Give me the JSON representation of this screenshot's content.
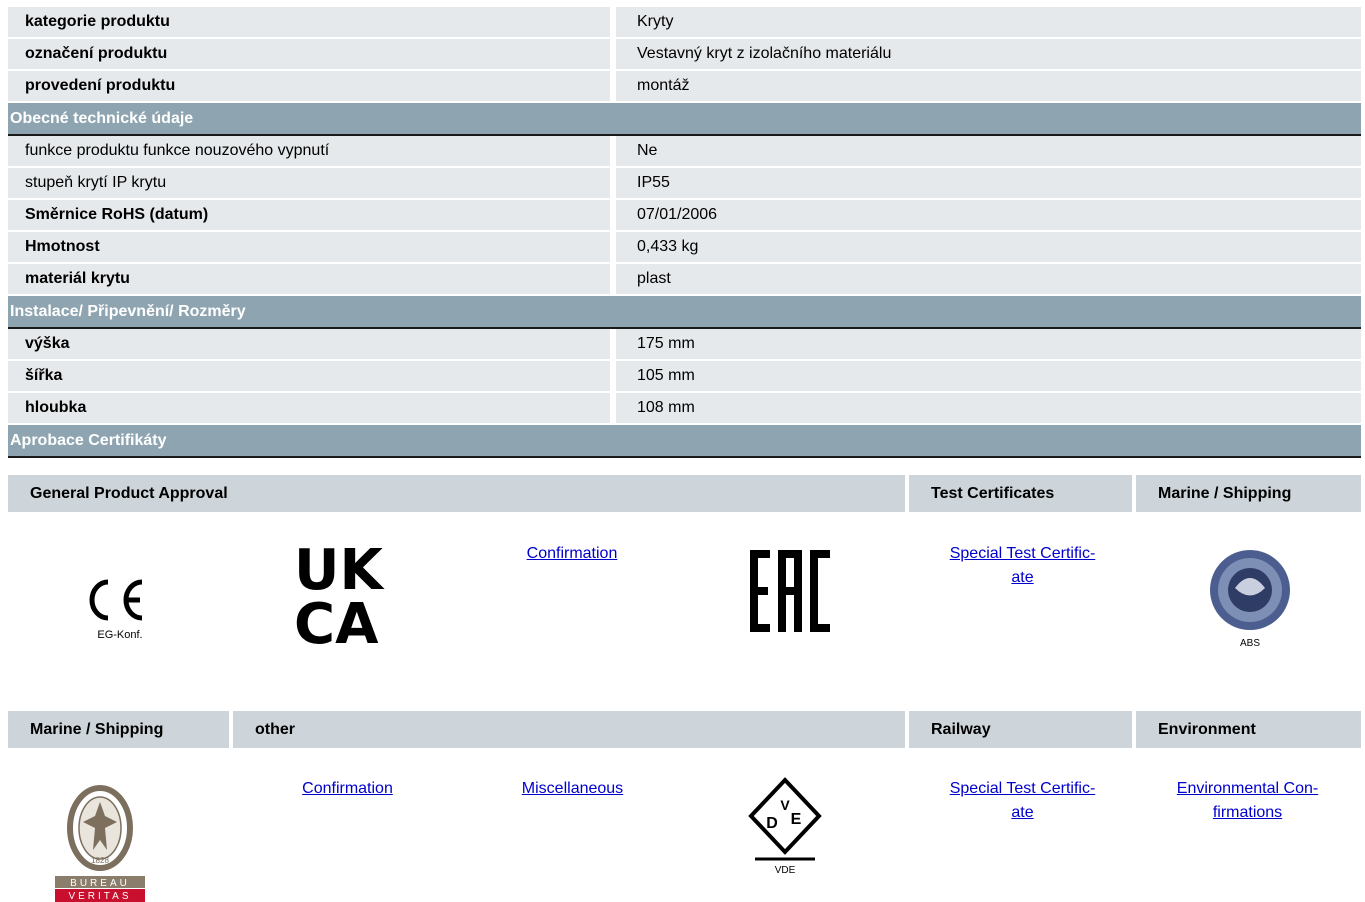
{
  "rows_top": [
    {
      "label": "kategorie produktu",
      "value": "Kryty",
      "bold": true
    },
    {
      "label": "označení produktu",
      "value": "Vestavný kryt z izolačního materiálu",
      "bold": true
    },
    {
      "label": "provedení produktu",
      "value": "montáž",
      "bold": true
    }
  ],
  "section_general": "Obecné technické údaje",
  "rows_general": [
    {
      "label": "funkce produktu funkce nouzového vypnutí",
      "value": "Ne",
      "bold": false
    },
    {
      "label": "stupeň krytí IP krytu",
      "value": "IP55",
      "bold": false
    },
    {
      "label": "Směrnice RoHS (datum)",
      "value": "07/01/2006",
      "bold": true
    },
    {
      "label": "Hmotnost",
      "value": "0,433 kg",
      "bold": true
    },
    {
      "label": "materiál krytu",
      "value": "plast",
      "bold": true
    }
  ],
  "section_install": "Instalace/ Připevnění/ Rozměry",
  "rows_install": [
    {
      "label": "výška",
      "value": "175 mm",
      "bold": true
    },
    {
      "label": "šířka",
      "value": "105 mm",
      "bold": true
    },
    {
      "label": "hloubka",
      "value": "108 mm",
      "bold": true
    }
  ],
  "section_approvals": "Aprobace Certifikáty",
  "cert_head_1": {
    "general": "General Product Approval",
    "test": "Test Certificates",
    "marine": "Marine / Shipping"
  },
  "cert_row_1": {
    "ce_caption": "EG-Konf.",
    "ukca_line1": "UK",
    "ukca_line2": "CA",
    "confirmation": "Confirmation",
    "eac": "EAC",
    "special_test": "Special Test Certific-ate",
    "abs_caption": "ABS"
  },
  "cert_head_2": {
    "marine": "Marine / Shipping",
    "other": "other",
    "railway": "Railway",
    "environment": "Environment"
  },
  "cert_row_2": {
    "bv_top": "BUREAU",
    "bv_bottom": "VERITAS",
    "bv_year": "1828",
    "confirmation": "Confirmation",
    "miscellaneous": "Miscellaneous",
    "vde_caption": "VDE",
    "vde_letters": "DVE",
    "special_test_line1": "Special Test Certific-",
    "special_test_line2": "ate",
    "env_line1": "Environmental Con-",
    "env_line2": "firmations"
  },
  "colors": {
    "section_bg": "#8ea5b1",
    "row_bg": "#e6e9eb",
    "head_bg": "#cdd5da",
    "link": "#0000cc",
    "bv_red": "#c8102e"
  }
}
